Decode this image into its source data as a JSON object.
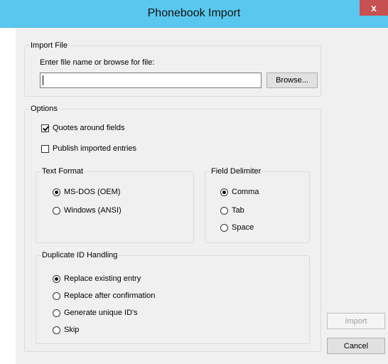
{
  "window": {
    "title": "Phonebook Import",
    "close_glyph": "x"
  },
  "import_file": {
    "legend": "Import File",
    "label": "Enter file name or browse for file:",
    "value": "",
    "browse_label": "Browse..."
  },
  "options": {
    "legend": "Options",
    "quotes": {
      "label": "Quotes around fields",
      "checked": true
    },
    "publish": {
      "label": "Publish imported entries",
      "checked": false
    },
    "text_format": {
      "legend": "Text Format",
      "items": [
        {
          "label": "MS-DOS (OEM)",
          "selected": true
        },
        {
          "label": "Windows (ANSI)",
          "selected": false
        }
      ]
    },
    "field_delimiter": {
      "legend": "Field Delimiter",
      "items": [
        {
          "label": "Comma",
          "selected": true
        },
        {
          "label": "Tab",
          "selected": false
        },
        {
          "label": "Space",
          "selected": false
        }
      ]
    },
    "duplicate": {
      "legend": "Duplicate ID Handling",
      "items": [
        {
          "label": "Replace existing entry",
          "selected": true
        },
        {
          "label": "Replace after confirmation",
          "selected": false
        },
        {
          "label": "Generate unique ID's",
          "selected": false
        },
        {
          "label": "Skip",
          "selected": false
        }
      ]
    }
  },
  "buttons": {
    "import_label": "Import",
    "cancel_label": "Cancel"
  }
}
